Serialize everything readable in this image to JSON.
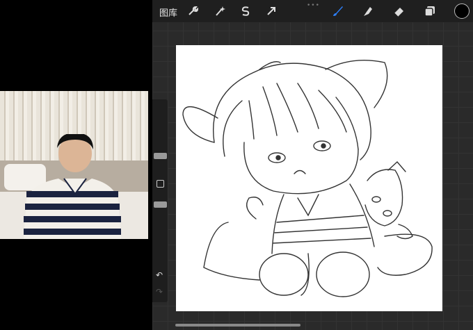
{
  "topbar": {
    "gallery_label": "图库",
    "tools": [
      "wrench-icon",
      "magic-wand-icon",
      "selection-icon",
      "transform-arrow-icon",
      "brush-icon",
      "smudge-icon",
      "eraser-icon",
      "layers-icon"
    ],
    "active_color": "#000000",
    "accent": "#2d7ff9"
  },
  "sidebar": {
    "undo_label": "↶",
    "redo_label": "↷"
  }
}
